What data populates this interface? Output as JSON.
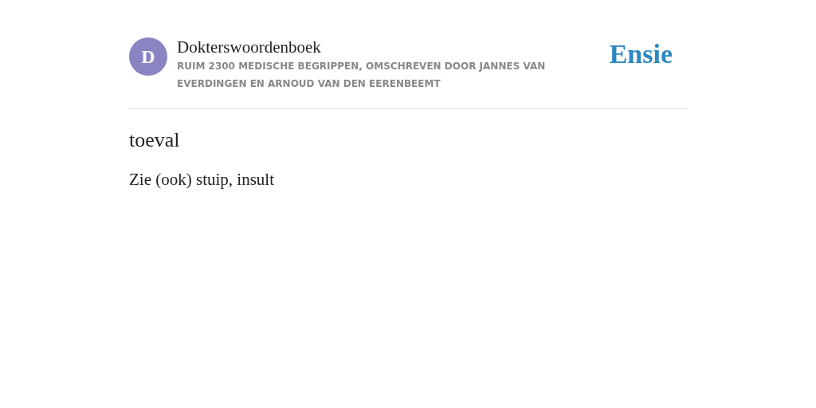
{
  "header": {
    "avatar_letter": "D",
    "title": "Dokterswoordenboek",
    "subtitle": "RUIM 2300 MEDISCHE BEGRIPPEN, OMSCHREVEN DOOR JANNES VAN EVERDINGEN EN ARNOUD VAN DEN EERENBEEMT",
    "logo": "Ensie"
  },
  "entry": {
    "term": "toeval",
    "definition": "Zie (ook) stuip, insult"
  }
}
